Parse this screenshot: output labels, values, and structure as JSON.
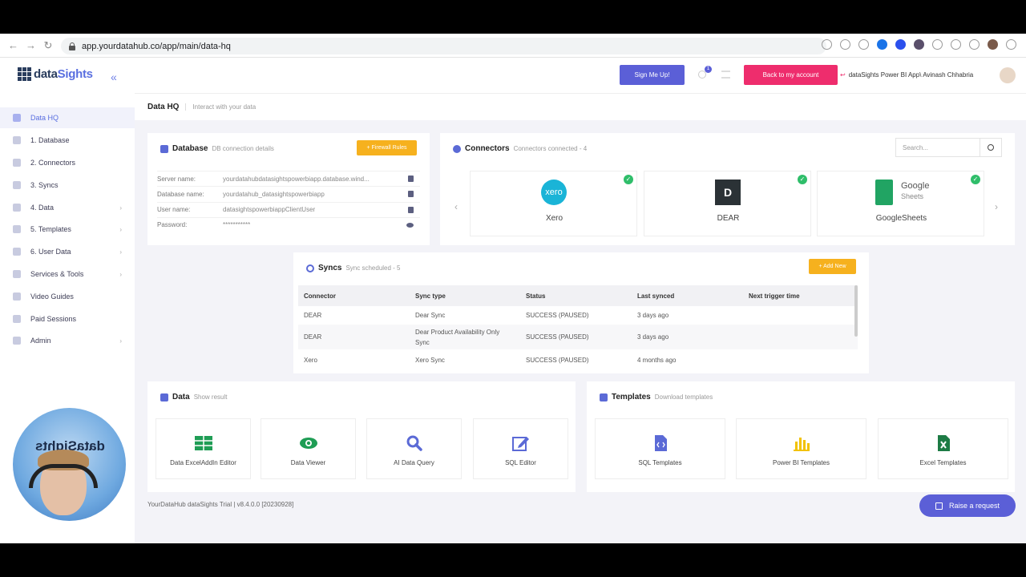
{
  "browser": {
    "url": "app.yourdatahub.co/app/main/data-hq"
  },
  "logo": {
    "part1": "data",
    "part2": "Sights"
  },
  "sidebar": {
    "items": [
      {
        "label": "Data HQ",
        "icon": "dashboard-icon",
        "active": true
      },
      {
        "label": "1. Database",
        "icon": "database-icon"
      },
      {
        "label": "2. Connectors",
        "icon": "link-icon"
      },
      {
        "label": "3. Syncs",
        "icon": "sync-icon"
      },
      {
        "label": "4. Data",
        "icon": "data-icon",
        "chevron": "›"
      },
      {
        "label": "5. Templates",
        "icon": "template-icon",
        "chevron": "›"
      },
      {
        "label": "6. User Data",
        "icon": "user-data-icon",
        "chevron": "›"
      },
      {
        "label": "Services & Tools",
        "icon": "tools-icon",
        "chevron": "›"
      },
      {
        "label": "Video Guides",
        "icon": "video-icon"
      },
      {
        "label": "Paid Sessions",
        "icon": "laptop-icon"
      },
      {
        "label": "Admin",
        "icon": "admin-icon",
        "chevron": "›"
      }
    ]
  },
  "topbar": {
    "signup_label": "Sign Me Up!",
    "notification_count": "1",
    "back_label": "Back to my account",
    "user_label": "dataSights Power BI App\\ Avinash Chhabria"
  },
  "subheader": {
    "title": "Data HQ",
    "subtitle": "Interact with your data"
  },
  "database": {
    "title": "Database",
    "subtitle": "DB connection details",
    "firewall_label": "+ Firewall Rules",
    "rows": [
      {
        "key": "Server name:",
        "value": "yourdatahubdatasightspowerbiapp.database.wind..."
      },
      {
        "key": "Database name:",
        "value": "yourdatahub_datasightspowerbiapp"
      },
      {
        "key": "User name:",
        "value": "datasightspowerbiappClientUser"
      },
      {
        "key": "Password:",
        "value": "***********"
      }
    ]
  },
  "connectors": {
    "title": "Connectors",
    "subtitle": "Connectors connected - 4",
    "search_placeholder": "Search...",
    "items": [
      {
        "name": "Xero",
        "logo_text": "xero"
      },
      {
        "name": "DEAR",
        "logo_text": "D"
      },
      {
        "name": "GoogleSheets",
        "logo_word": "Google",
        "logo_word2": "Sheets"
      }
    ]
  },
  "syncs": {
    "title": "Syncs",
    "subtitle": "Sync scheduled - 5",
    "add_label": "+ Add New",
    "columns": [
      "Connector",
      "Sync type",
      "Status",
      "Last synced",
      "Next trigger time"
    ],
    "rows": [
      {
        "connector": "DEAR",
        "sync_type": "Dear Sync",
        "status": "SUCCESS (PAUSED)",
        "last_synced": "3 days ago",
        "next": ""
      },
      {
        "connector": "DEAR",
        "sync_type": "Dear Product Availability Only Sync",
        "status": "SUCCESS (PAUSED)",
        "last_synced": "3 days ago",
        "next": ""
      },
      {
        "connector": "Xero",
        "sync_type": "Xero Sync",
        "status": "SUCCESS (PAUSED)",
        "last_synced": "4 months ago",
        "next": ""
      }
    ]
  },
  "data_section": {
    "title": "Data",
    "subtitle": "Show result",
    "tiles": [
      {
        "label": "Data ExcelAddIn Editor",
        "icon": "table-icon"
      },
      {
        "label": "Data Viewer",
        "icon": "eye-icon"
      },
      {
        "label": "AI Data Query",
        "icon": "search-icon"
      },
      {
        "label": "SQL Editor",
        "icon": "edit-icon"
      }
    ]
  },
  "templates_section": {
    "title": "Templates",
    "subtitle": "Download templates",
    "tiles": [
      {
        "label": "SQL Templates",
        "icon": "code-file-icon"
      },
      {
        "label": "Power BI Templates",
        "icon": "bar-chart-icon"
      },
      {
        "label": "Excel Templates",
        "icon": "excel-icon"
      }
    ]
  },
  "footer": {
    "text": "YourDataHub dataSights Trial | v8.4.0.0 [20230928]"
  },
  "raise_label": "Raise a request",
  "webcam": {
    "watermark": "dataSights"
  },
  "colors": {
    "primary": "#5b5fd7",
    "accent_pink": "#ee2d6d",
    "accent_yellow": "#f6b11e",
    "success": "#2fbe6a"
  }
}
